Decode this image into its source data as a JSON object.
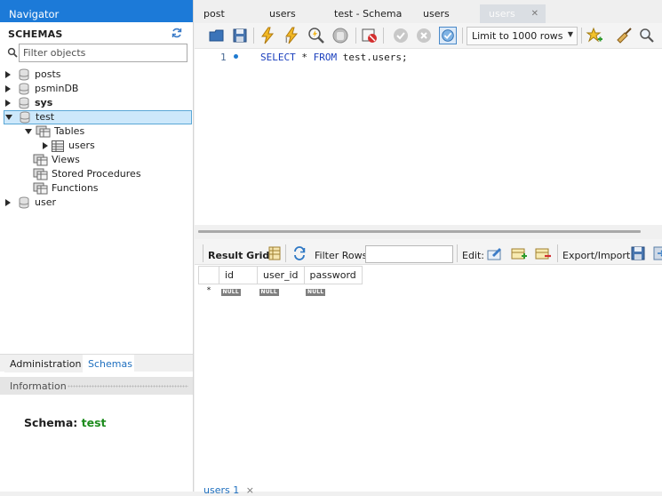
{
  "navigator": {
    "title": "Navigator",
    "schemas_label": "SCHEMAS",
    "filter_placeholder": "Filter objects",
    "tree": {
      "posts": "posts",
      "psminDB": "psminDB",
      "sys": "sys",
      "test": "test",
      "tables": "Tables",
      "users": "users",
      "views": "Views",
      "stored_procedures": "Stored Procedures",
      "functions": "Functions",
      "user": "user"
    },
    "bottom_tabs": {
      "administration": "Administration",
      "schemas": "Schemas"
    },
    "information_label": "Information",
    "schema_info": {
      "label": "Schema:",
      "value": "test"
    }
  },
  "tabs": [
    {
      "label": "post"
    },
    {
      "label": "users"
    },
    {
      "label": "test - Schema"
    },
    {
      "label": "users"
    },
    {
      "label": "users",
      "active": true,
      "close": "✕"
    }
  ],
  "toolbar": {
    "limit_rows": "Limit to 1000 rows"
  },
  "editor": {
    "line_number": "1",
    "sql": {
      "select": "SELECT",
      "star": "*",
      "from": "FROM",
      "target": "test.users;"
    }
  },
  "result_bar": {
    "result_grid": "Result Grid",
    "filter_rows": "Filter Rows:",
    "edit": "Edit:",
    "export_import": "Export/Import:"
  },
  "grid": {
    "columns": [
      "id",
      "user_id",
      "password"
    ],
    "null_label": "NULL",
    "new_row_marker": "*"
  },
  "bottom_tab": {
    "label": "users 1",
    "close": "×"
  },
  "colors": {
    "accent": "#1c7ad8",
    "selected_row": "#cde8fb",
    "keyword": "#1a3fbd",
    "schema_value": "#1e8c1e"
  }
}
